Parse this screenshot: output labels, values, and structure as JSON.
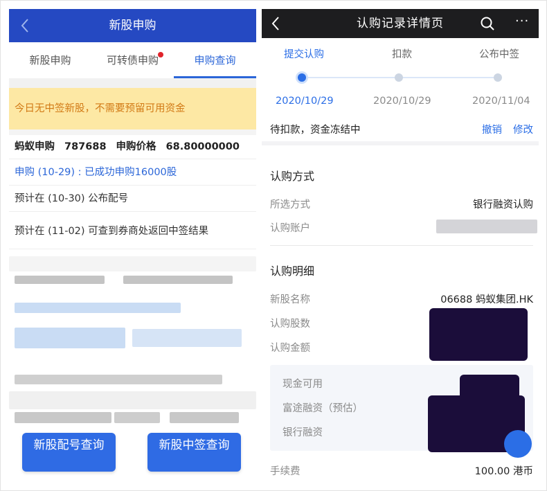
{
  "left": {
    "header": {
      "title": "新股申购"
    },
    "tabs": [
      {
        "label": "新股申购"
      },
      {
        "label": "可转债申购"
      },
      {
        "label": "申购查询"
      }
    ],
    "notice": "今日无中签新股，不需要预留可用资金",
    "info": {
      "name": "蚂蚁申购",
      "code": "787688",
      "price_label": "申购价格",
      "price": "68.80000000"
    },
    "rows": [
      "申购 (10-29) : 已成功申购16000股",
      "预计在 (10-30) 公布配号",
      "预计在 (11-02) 可查到券商处返回中签结果"
    ],
    "buttons": {
      "allotment": "新股配号查询",
      "winning": "新股中签查询"
    }
  },
  "right": {
    "header": {
      "title": "认购记录详情页"
    },
    "steps": [
      {
        "label": "提交认购",
        "date": "2020/10/29"
      },
      {
        "label": "扣款",
        "date": "2020/10/29"
      },
      {
        "label": "公布中签",
        "date": "2020/11/04"
      }
    ],
    "status": {
      "text": "待扣款，资金冻结中",
      "cancel": "撤销",
      "modify": "修改"
    },
    "method": {
      "title": "认购方式",
      "selected_label": "所选方式",
      "selected_value": "银行融资认购",
      "account_label": "认购账户"
    },
    "detail": {
      "title": "认购明细",
      "stock_label": "新股名称",
      "stock_value": "06688 蚂蚁集团.HK",
      "shares_label": "认购股数",
      "amount_label": "认购金额",
      "cash_label": "现金可用",
      "futu_label": "富途融资（预估）",
      "bank_label": "银行融资",
      "fee_label": "手续费",
      "fee_value": "100.00 港币"
    }
  },
  "colors": {
    "left_header": "#2549c2",
    "right_header": "#1d1d1f",
    "accent": "#2b6ee6",
    "notice_bg": "#fde8a4",
    "notice_text": "#d27a16"
  },
  "icons": [
    "back-icon",
    "search-icon",
    "more-icon"
  ]
}
